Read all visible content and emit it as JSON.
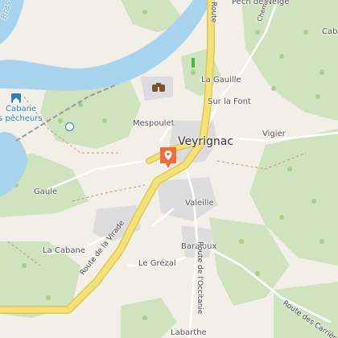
{
  "map": {
    "places": {
      "pech_de_neige": "Pech de Neige",
      "cab": "Cab",
      "la_gauille": "La Gauille",
      "sur_la_font": "Sur la Font",
      "mespoulet": "Mespoulet",
      "veyrignac": "Veyrignac",
      "vigier": "Vigier",
      "gaule": "Gaule",
      "valeille": "Valeille",
      "barajoux": "Barajoux",
      "la_cabane": "La Cabane",
      "le_grezal": "Le Grézal",
      "labarthe": "Labarthe"
    },
    "poi": {
      "cabane_line1": "Cabane",
      "cabane_line2": "s pêcheurs"
    },
    "water": {
      "river_arm": "Bras de"
    },
    "roads": {
      "route_virade": "Route de la Virade",
      "route_occitanie": "Route de l'Occitanie",
      "route_carrieres": "Route des Carrières",
      "chemin_neige": "Chemin de Neige",
      "route_top": "Route"
    },
    "colors": {
      "land": "#f2efe9",
      "forest": "#cfe3bf",
      "water": "#a8d3ec",
      "road_major": "#f3e27a",
      "road_casing": "#e2c74f",
      "marker": "#f26b3a",
      "poi_blue": "#2b83b5"
    },
    "icons": {
      "marker": "map-pin-icon",
      "viewpoint": "binoculars-icon",
      "cabane": "fishing-hut-icon"
    }
  }
}
